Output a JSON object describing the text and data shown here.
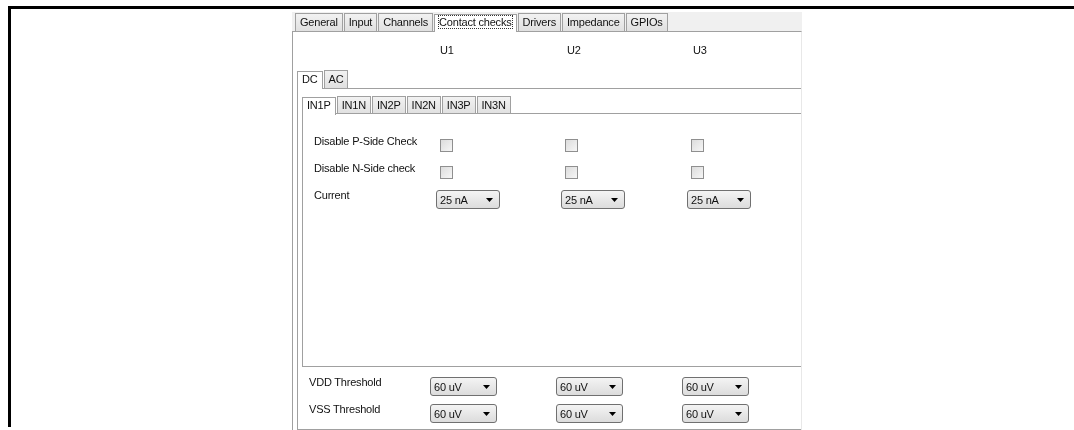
{
  "tabs": [
    {
      "label": "General",
      "selected": false
    },
    {
      "label": "Input",
      "selected": false
    },
    {
      "label": "Channels",
      "selected": false
    },
    {
      "label": "Contact checks",
      "selected": true
    },
    {
      "label": "Drivers",
      "selected": false
    },
    {
      "label": "Impedance",
      "selected": false
    },
    {
      "label": "GPIOs",
      "selected": false
    }
  ],
  "units": [
    "U1",
    "U2",
    "U3"
  ],
  "mode_tabs": [
    {
      "label": "DC",
      "selected": true
    },
    {
      "label": "AC",
      "selected": false
    }
  ],
  "input_tabs": [
    {
      "label": "IN1P",
      "selected": true
    },
    {
      "label": "IN1N",
      "selected": false
    },
    {
      "label": "IN2P",
      "selected": false
    },
    {
      "label": "IN2N",
      "selected": false
    },
    {
      "label": "IN3P",
      "selected": false
    },
    {
      "label": "IN3N",
      "selected": false
    }
  ],
  "rows": [
    {
      "label": "Disable P-Side Check",
      "kind": "checkbox",
      "cells": [
        {
          "checked": false
        },
        {
          "checked": false
        },
        {
          "checked": false
        }
      ]
    },
    {
      "label": "Disable N-Side check",
      "kind": "checkbox",
      "cells": [
        {
          "checked": false
        },
        {
          "checked": false
        },
        {
          "checked": false
        }
      ]
    },
    {
      "label": "Current",
      "kind": "dropdown",
      "cells": [
        {
          "value": "25 nA"
        },
        {
          "value": "25 nA"
        },
        {
          "value": "25 nA"
        }
      ]
    }
  ],
  "thresholds": [
    {
      "label": "VDD Threshold",
      "cells": [
        {
          "value": "60 uV"
        },
        {
          "value": "60 uV"
        },
        {
          "value": "60 uV"
        }
      ]
    },
    {
      "label": "VSS Threshold",
      "cells": [
        {
          "value": "60 uV"
        },
        {
          "value": "60 uV"
        },
        {
          "value": "60 uV"
        }
      ]
    }
  ]
}
